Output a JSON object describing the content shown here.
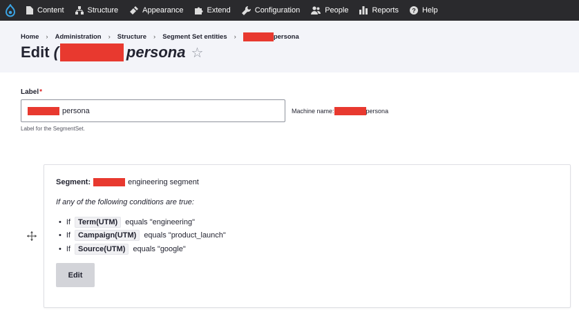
{
  "toolbar": {
    "items": [
      {
        "label": "Content",
        "icon": "file-icon"
      },
      {
        "label": "Structure",
        "icon": "sitemap-icon"
      },
      {
        "label": "Appearance",
        "icon": "brush-icon"
      },
      {
        "label": "Extend",
        "icon": "puzzle-icon"
      },
      {
        "label": "Configuration",
        "icon": "wrench-icon"
      },
      {
        "label": "People",
        "icon": "people-icon"
      },
      {
        "label": "Reports",
        "icon": "bar-chart-icon"
      },
      {
        "label": "Help",
        "icon": "help-icon"
      }
    ]
  },
  "breadcrumb": [
    "Home",
    "Administration",
    "Structure",
    "Segment Set entities",
    "persona"
  ],
  "page": {
    "title_prefix": "Edit",
    "title_suffix": "persona",
    "star": "☆"
  },
  "form": {
    "label": "Label",
    "required_mark": "*",
    "value_suffix": "persona",
    "machine_name_label": "Machine name:",
    "machine_name_suffix": "persona",
    "description": "Label for the SegmentSet."
  },
  "segment": {
    "title_label": "Segment:",
    "title_suffix": "engineering segment",
    "intro": "If any of the following conditions are true:",
    "conditions": [
      {
        "prefix": "If",
        "field": "Term(UTM)",
        "text": "equals \"engineering\""
      },
      {
        "prefix": "If",
        "field": "Campaign(UTM)",
        "text": "equals \"product_launch\""
      },
      {
        "prefix": "If",
        "field": "Source(UTM)",
        "text": "equals \"google\""
      }
    ],
    "bullet": "•",
    "edit_label": "Edit"
  },
  "colors": {
    "toolbar_bg": "#2a2a2d",
    "header_bg": "#f3f4f9",
    "redaction": "#e8392f",
    "button_bg": "#d3d4d9",
    "drupal_blue": "#0678be"
  }
}
